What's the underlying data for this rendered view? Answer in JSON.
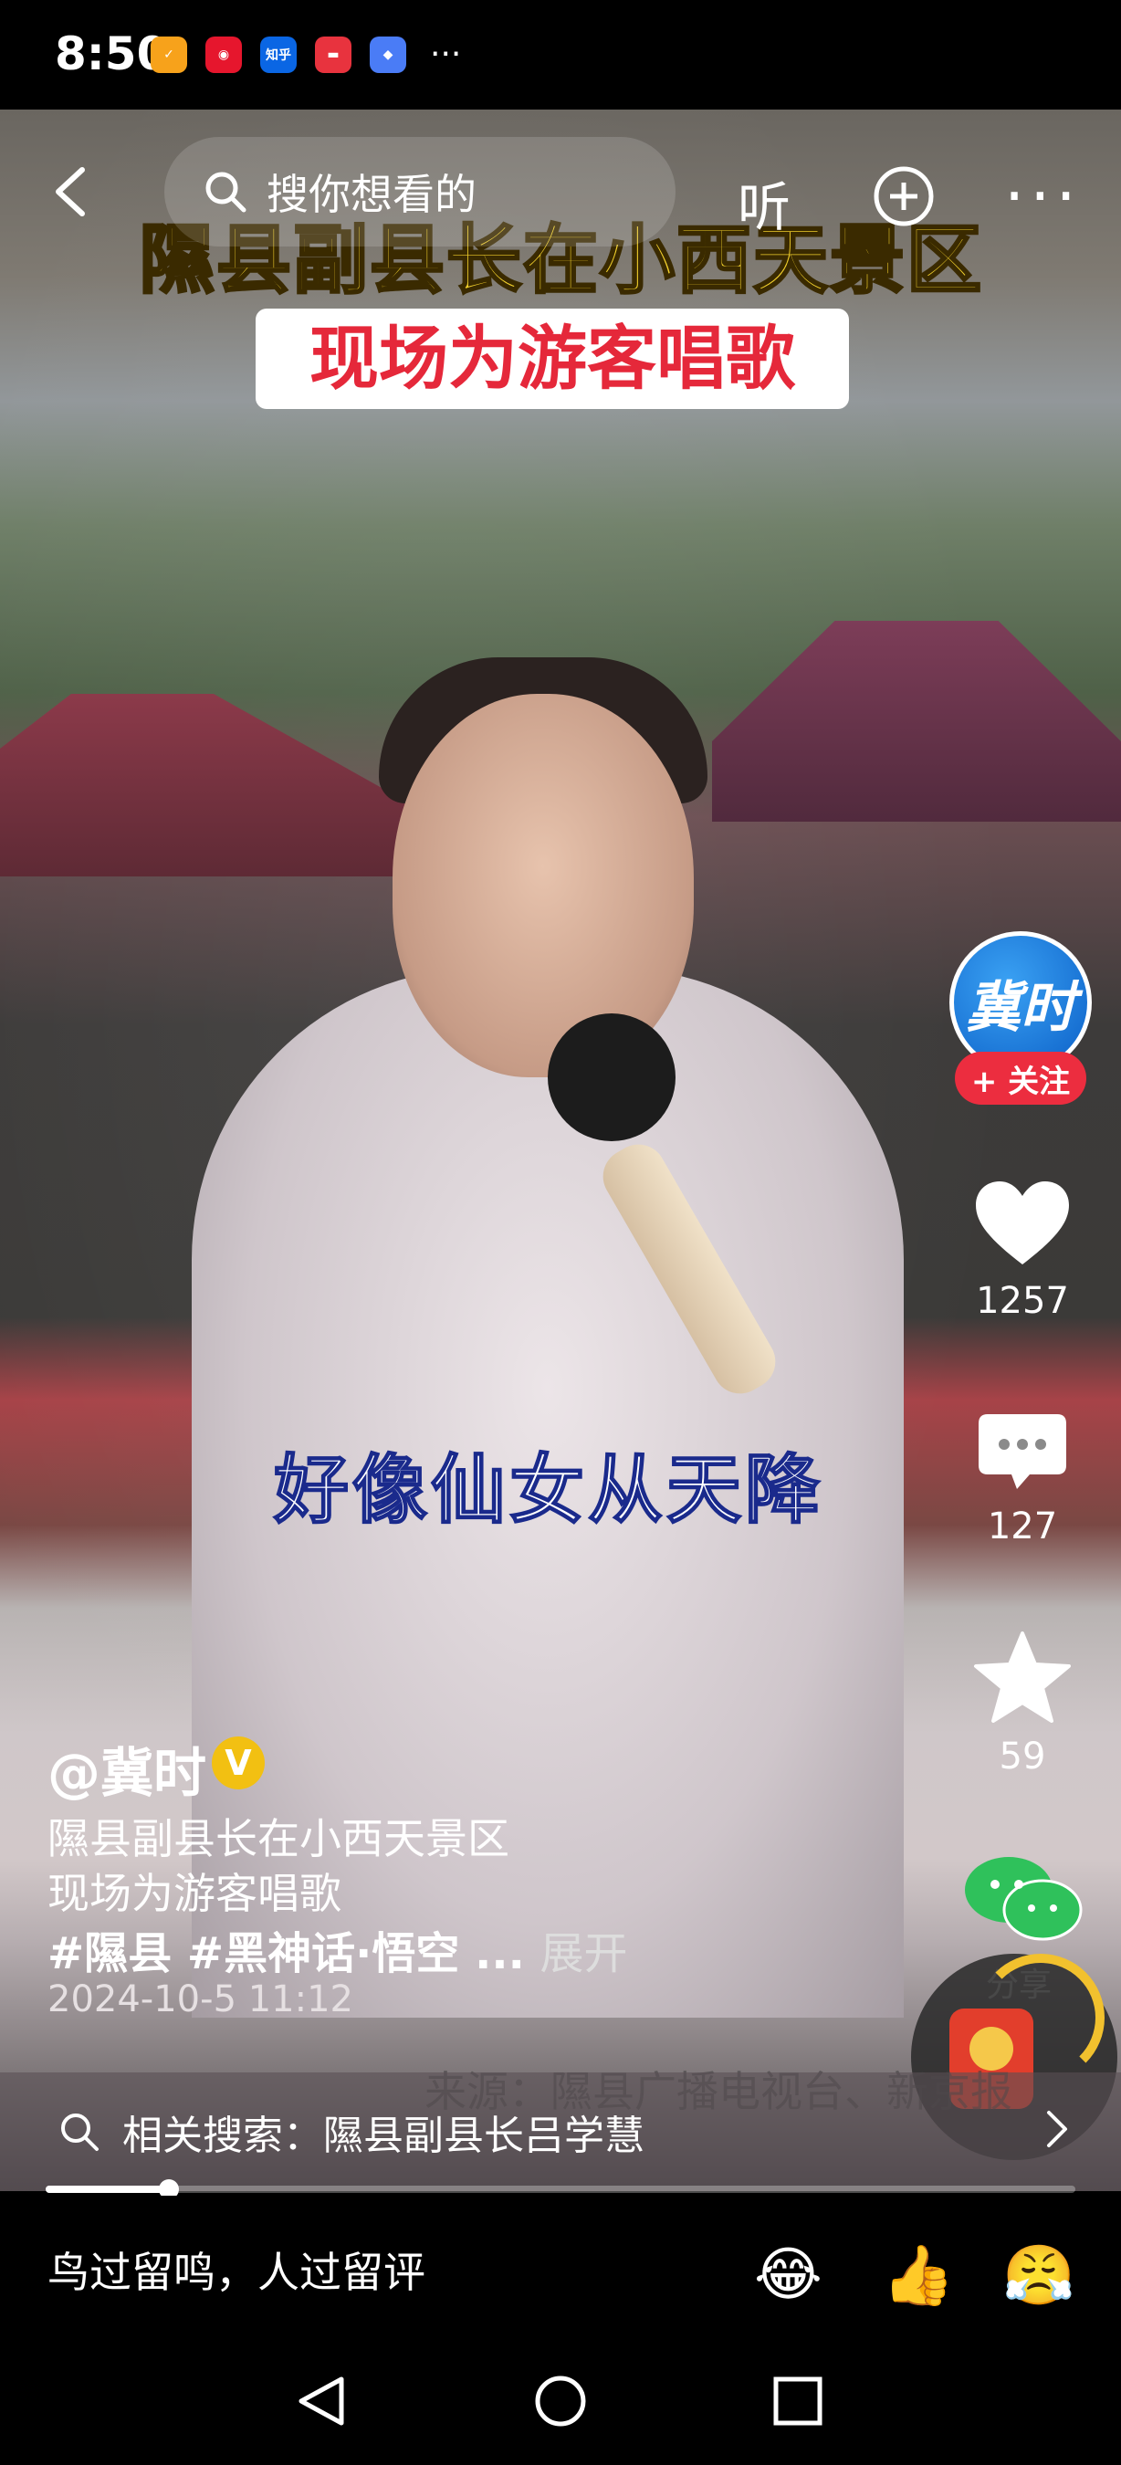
{
  "status_bar": {
    "time": "8:50",
    "app_icons": [
      {
        "name": "taobao-icon",
        "label": "",
        "color": "#f7a21b"
      },
      {
        "name": "weibo-icon",
        "label": "",
        "color": "#e6162d"
      },
      {
        "name": "zhihu-icon",
        "label": "知乎",
        "color": "#0a66e4"
      },
      {
        "name": "huawei-icon",
        "label": "",
        "color": "#e8333e"
      },
      {
        "name": "app-icon",
        "label": "",
        "color": "#4a7cf6"
      }
    ],
    "more": "···"
  },
  "top_bar": {
    "search_placeholder": "搜你想看的",
    "listen_label": "听"
  },
  "video": {
    "title_line1": "隰县副县长在小西天景区",
    "title_line2": "现场为游客唱歌",
    "lyric": "好像仙女从天降",
    "source_watermark": "来源：隰县广播电视台、新京报"
  },
  "right_rail": {
    "avatar_text": "冀时",
    "follow_label": "+ 关注",
    "likes": "1257",
    "comments": "127",
    "favorites": "59",
    "share_label": "分享"
  },
  "caption": {
    "author": "@冀时",
    "verified": "V",
    "line1": "隰县副县长在小西天景区",
    "line2": "现场为游客唱歌",
    "tags": "#隰县 #黑神话·悟空 ...",
    "expand": "展开",
    "date": "2024-10-5 11:12"
  },
  "related_search": {
    "label": "相关搜索：隰县副县长吕学慧"
  },
  "progress": {
    "fraction": 0.12
  },
  "comment_bar": {
    "placeholder": "鸟过留鸣，人过留评",
    "emojis": [
      "😂",
      "👍",
      "😤"
    ]
  }
}
